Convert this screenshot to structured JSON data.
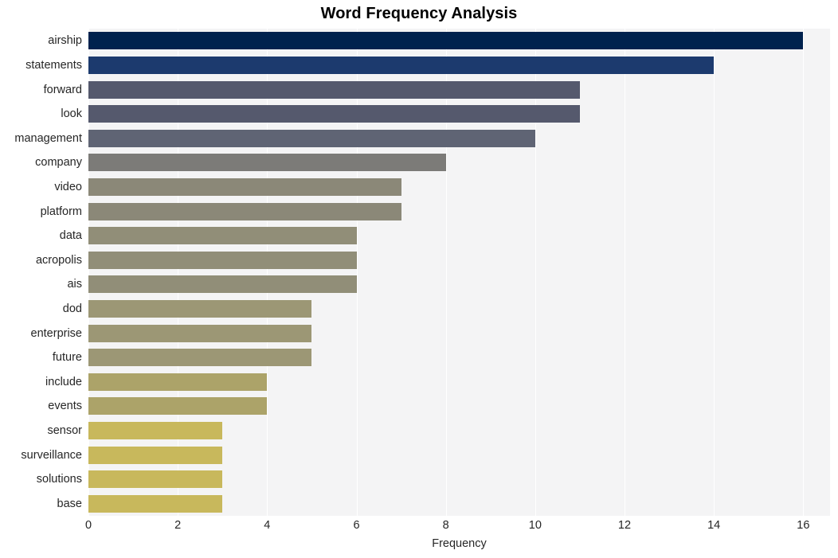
{
  "chart_data": {
    "type": "bar",
    "orientation": "horizontal",
    "title": "Word Frequency Analysis",
    "xlabel": "Frequency",
    "ylabel": "",
    "xlim": [
      0,
      16.6
    ],
    "xticks": [
      0,
      2,
      4,
      6,
      8,
      10,
      12,
      14,
      16
    ],
    "xtick_labels": [
      "0",
      "2",
      "4",
      "6",
      "8",
      "10",
      "12",
      "14",
      "16"
    ],
    "grid": true,
    "grid_axis": "x",
    "legend": false,
    "categories": [
      "airship",
      "statements",
      "forward",
      "look",
      "management",
      "company",
      "video",
      "platform",
      "data",
      "acropolis",
      "ais",
      "dod",
      "enterprise",
      "future",
      "include",
      "events",
      "sensor",
      "surveillance",
      "solutions",
      "base"
    ],
    "values": [
      16,
      14,
      11,
      11,
      10,
      8,
      7,
      7,
      6,
      6,
      6,
      5,
      5,
      5,
      4,
      4,
      3,
      3,
      3,
      3
    ],
    "colormap": "cividis",
    "bar_colors": [
      "#00224e",
      "#1c3a6e",
      "#55596d",
      "#55596d",
      "#5f6474",
      "#7c7b78",
      "#8b8878",
      "#8b8878",
      "#918e78",
      "#918e78",
      "#918e78",
      "#9c9775",
      "#9c9775",
      "#9c9775",
      "#aca369",
      "#aca369",
      "#c8b85c",
      "#c8b85c",
      "#c8b85c",
      "#c8b85c"
    ]
  },
  "style": {
    "figure_background": "#ffffff",
    "axes_background": "#f4f4f5",
    "grid_color": "#ffffff",
    "text_color": "#262626",
    "title_color": "#000000"
  }
}
